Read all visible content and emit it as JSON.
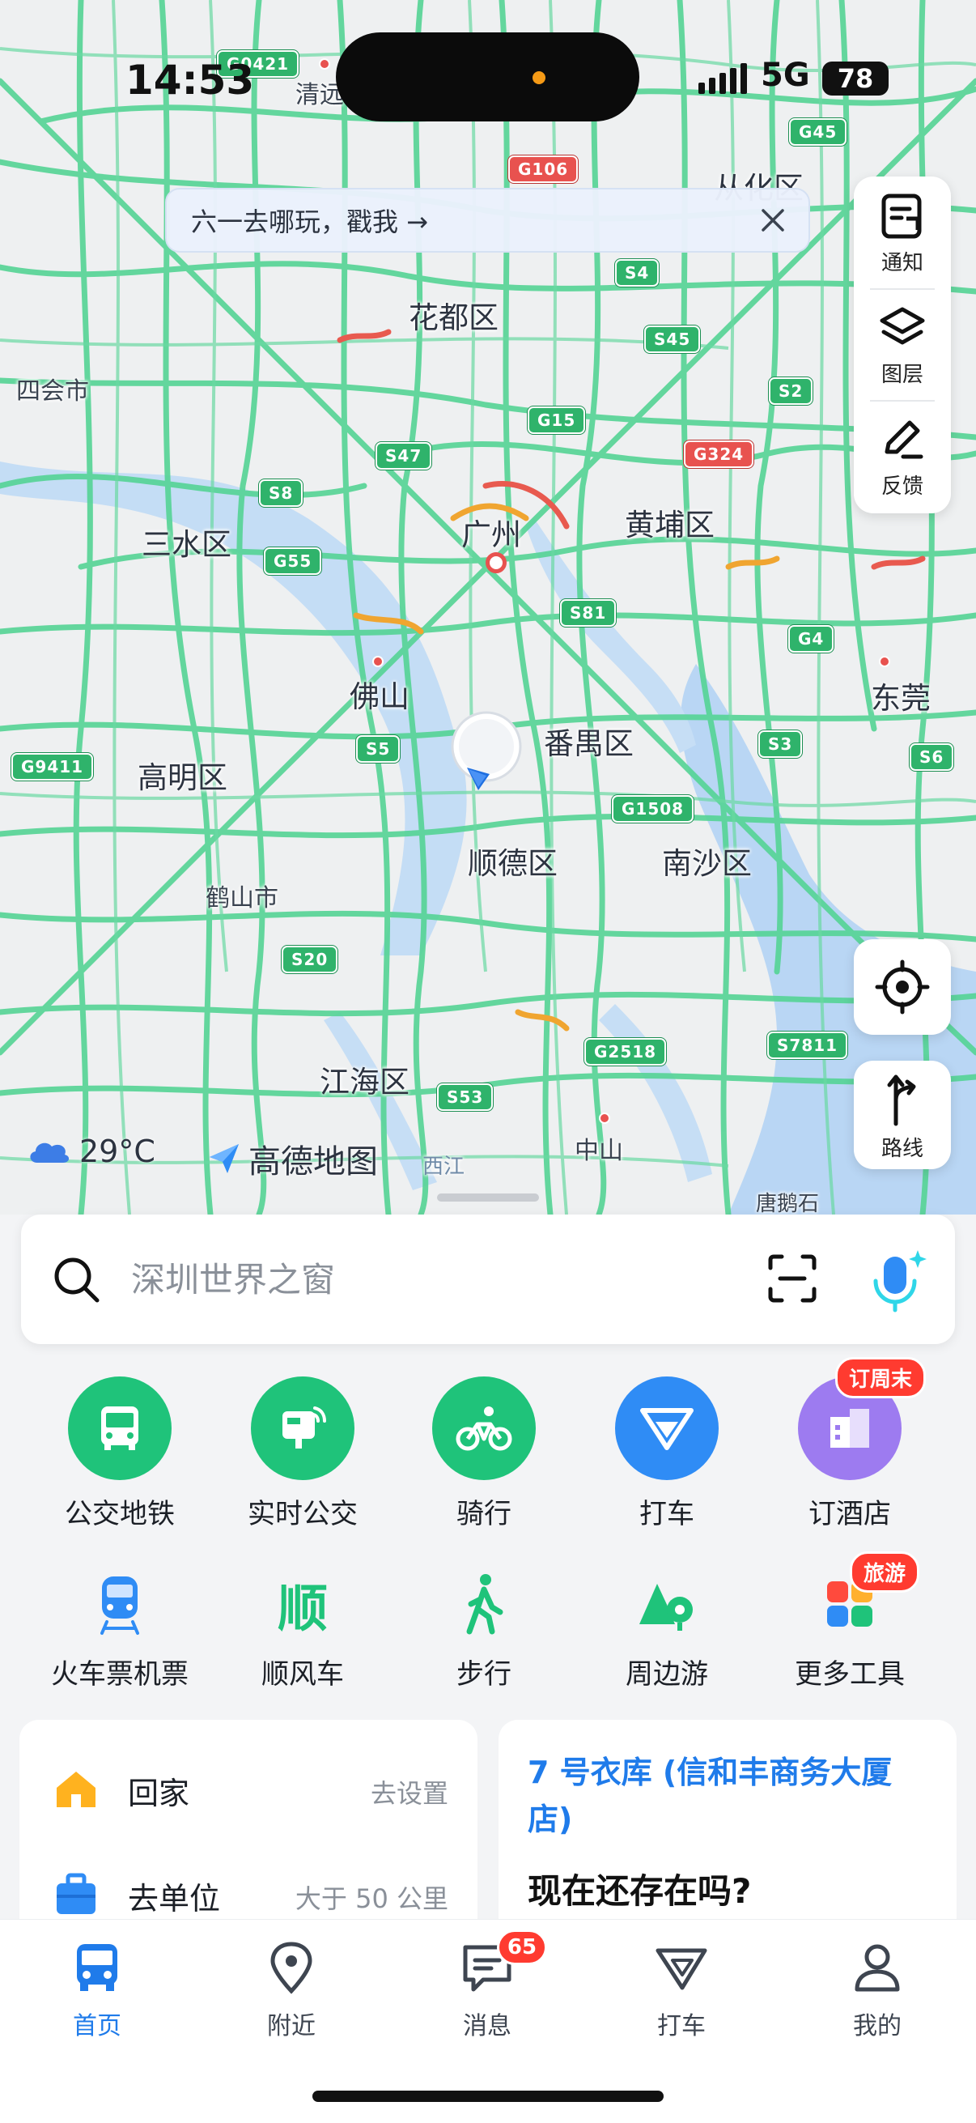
{
  "status": {
    "time": "14:53",
    "network": "5G",
    "battery": "78"
  },
  "notice": {
    "text": "六一去哪玩，戳我 →"
  },
  "map": {
    "places": [
      "花都区",
      "从化区",
      "四会市",
      "三水区",
      "广州",
      "黄埔区",
      "佛山",
      "番禺区",
      "高明区",
      "东莞",
      "顺德区",
      "南沙区",
      "鹤山市",
      "江海区",
      "中山",
      "唐鹅石",
      "清远",
      "西江"
    ],
    "roads": [
      "G0421",
      "G45",
      "G106",
      "S4",
      "S45",
      "S2",
      "G15",
      "S47",
      "G324",
      "S8",
      "G55",
      "S81",
      "G4",
      "S5",
      "S3",
      "S6",
      "G9411",
      "G1508",
      "S20",
      "S7811",
      "G2518",
      "S53"
    ]
  },
  "tools": {
    "notify": "通知",
    "layers": "图层",
    "feedback": "反馈",
    "route": "路线"
  },
  "weather": {
    "temp": "29°C"
  },
  "brand": {
    "name": "高德地图"
  },
  "search": {
    "placeholder": "深圳世界之窗"
  },
  "quick_actions": [
    {
      "label": "公交地铁",
      "icon": "bus-icon",
      "color": "#1fc37a"
    },
    {
      "label": "实时公交",
      "icon": "realtime-bus-icon",
      "color": "#1fc37a"
    },
    {
      "label": "骑行",
      "icon": "bike-icon",
      "color": "#1fc37a"
    },
    {
      "label": "打车",
      "icon": "taxi-icon",
      "color": "#2f8cf5"
    },
    {
      "label": "订酒店",
      "icon": "hotel-icon",
      "color": "#9d7bf0",
      "tag": "订周末"
    }
  ],
  "quick_actions_2": [
    {
      "label": "火车票机票",
      "icon": "train-icon"
    },
    {
      "label": "顺风车",
      "icon": "carpool-icon",
      "glyph": "顺"
    },
    {
      "label": "步行",
      "icon": "walk-icon"
    },
    {
      "label": "周边游",
      "icon": "nearby-trip-icon"
    },
    {
      "label": "更多工具",
      "icon": "more-tools-icon",
      "tag": "旅游"
    }
  ],
  "shortcuts": {
    "home": {
      "label": "回家",
      "action": "去设置"
    },
    "work": {
      "label": "去单位",
      "distance": "大于 50 公里"
    }
  },
  "poi_card": {
    "name": "7 号衣库 (信和丰商务大厦店)",
    "question": "现在还存在吗?"
  },
  "tabs": [
    {
      "label": "首页",
      "icon": "home-bus-icon",
      "active": true
    },
    {
      "label": "附近",
      "icon": "location-pin-icon"
    },
    {
      "label": "消息",
      "icon": "message-icon",
      "badge": "65"
    },
    {
      "label": "打车",
      "icon": "taxi-tab-icon"
    },
    {
      "label": "我的",
      "icon": "profile-icon"
    }
  ]
}
